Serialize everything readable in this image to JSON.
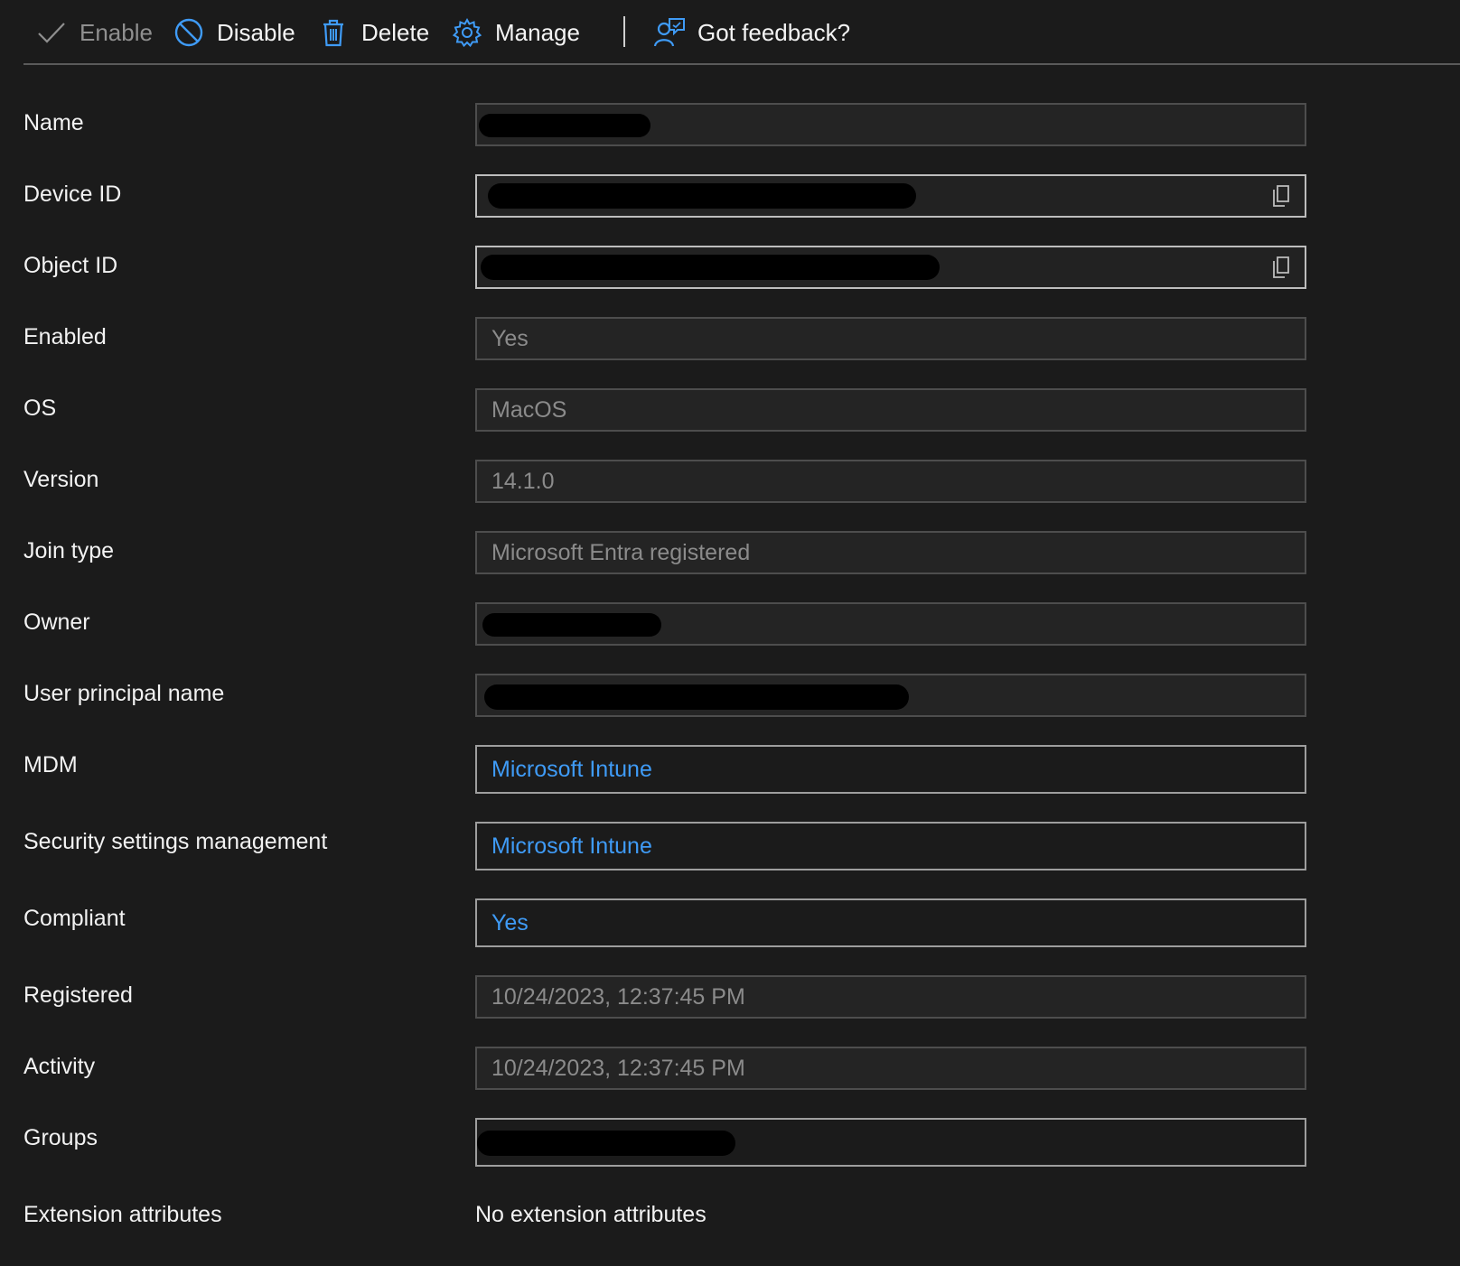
{
  "toolbar": {
    "enable": {
      "label": "Enable",
      "icon": "checkmark-icon",
      "state": "disabled"
    },
    "disable": {
      "label": "Disable",
      "icon": "block-icon"
    },
    "delete": {
      "label": "Delete",
      "icon": "trash-icon"
    },
    "manage": {
      "label": "Manage",
      "icon": "gear-icon"
    },
    "feedback": {
      "label": "Got feedback?",
      "icon": "feedback-person-icon"
    }
  },
  "colors": {
    "background": "#1b1b1b",
    "accent_icon": "#3f9bf6",
    "link": "#3f9bf6",
    "readonly_text": "#8b8b8b"
  },
  "properties": {
    "name": {
      "label": "Name",
      "value": "[redacted]"
    },
    "device_id": {
      "label": "Device ID",
      "value": "[redacted]"
    },
    "object_id": {
      "label": "Object ID",
      "value": "[redacted]"
    },
    "enabled": {
      "label": "Enabled",
      "value": "Yes"
    },
    "os": {
      "label": "OS",
      "value": "MacOS"
    },
    "version": {
      "label": "Version",
      "value": "14.1.0"
    },
    "join_type": {
      "label": "Join type",
      "value": "Microsoft Entra registered"
    },
    "owner": {
      "label": "Owner",
      "value": "[redacted]"
    },
    "upn": {
      "label": "User principal name",
      "value": "[redacted]"
    },
    "mdm": {
      "label": "MDM",
      "value": "Microsoft Intune"
    },
    "security_mgmt": {
      "label": "Security settings management",
      "value": "Microsoft Intune"
    },
    "compliant": {
      "label": "Compliant",
      "value": "Yes"
    },
    "registered": {
      "label": "Registered",
      "value": "10/24/2023, 12:37:45 PM"
    },
    "activity": {
      "label": "Activity",
      "value": "10/24/2023, 12:37:45 PM"
    },
    "groups": {
      "label": "Groups",
      "value": "[redacted]"
    },
    "extension_attributes": {
      "label": "Extension attributes",
      "value": "No extension attributes"
    }
  }
}
